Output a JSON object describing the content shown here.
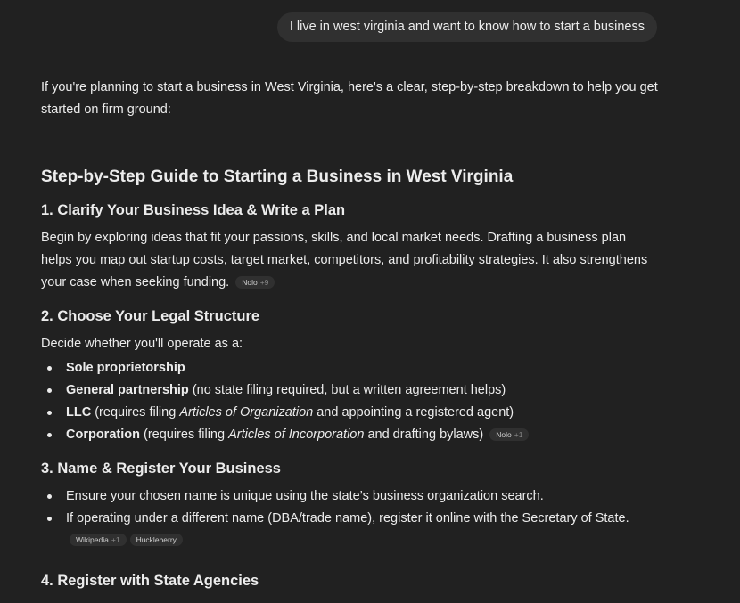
{
  "user_message": "I live in west virginia and want to know how to start a business",
  "reply": {
    "intro": "If you're planning to start a business in West Virginia, here's a clear, step-by-step breakdown to help you get started on firm ground:",
    "title": "Step-by-Step Guide to Starting a Business in West Virginia",
    "sections": [
      {
        "heading": "1. Clarify Your Business Idea & Write a Plan",
        "body": "Begin by exploring ideas that fit your passions, skills, and local market needs. Drafting a business plan helps you map out startup costs, target market, competitors, and profitability strategies. It also strengthens your case when seeking funding.",
        "source": {
          "label": "Nolo",
          "more": "+9"
        }
      },
      {
        "heading": "2. Choose Your Legal Structure",
        "lead": "Decide whether you'll operate as a:",
        "items": [
          {
            "bold": "Sole proprietorship"
          },
          {
            "bold": "General partnership",
            "rest": " (no state filing required, but a written agreement helps)"
          },
          {
            "bold": "LLC",
            "pre": " (requires filing ",
            "ital": "Articles of Organization",
            "post": " and appointing a registered agent)"
          },
          {
            "bold": "Corporation",
            "pre": " (requires filing ",
            "ital": "Articles of Incorporation",
            "post": " and drafting bylaws)"
          }
        ],
        "source": {
          "label": "Nolo",
          "more": "+1"
        }
      },
      {
        "heading": "3. Name & Register Your Business",
        "items": [
          "Ensure your chosen name is unique using the state’s business organization search.",
          "If operating under a different name (DBA/trade name), register it online with the Secretary of State."
        ],
        "sources": [
          {
            "label": "Wikipedia",
            "more": "+1"
          },
          {
            "label": "Huckleberry"
          }
        ]
      },
      {
        "heading": "4. Register with State Agencies"
      }
    ]
  },
  "colors": {
    "background": "#212121",
    "bubble": "#303030",
    "text": "#ececec",
    "pill": "#303030"
  }
}
